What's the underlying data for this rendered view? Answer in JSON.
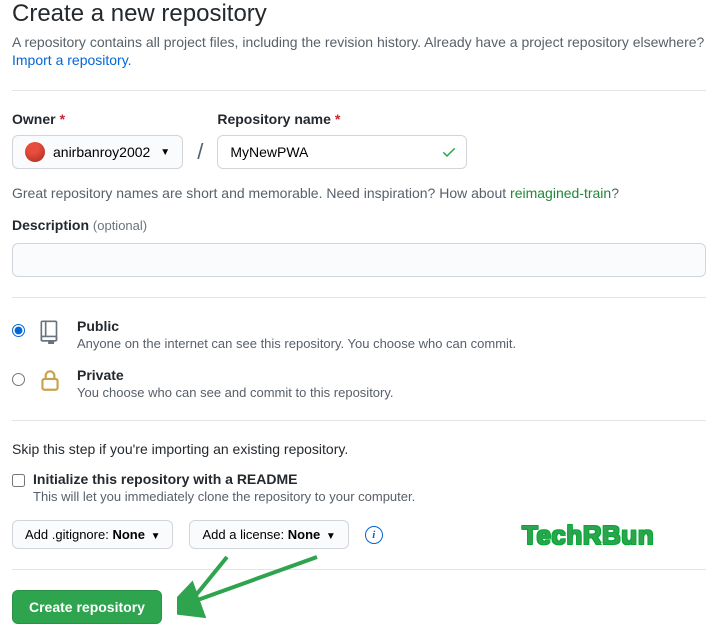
{
  "header": {
    "title": "Create a new repository",
    "subtitle": "A repository contains all project files, including the revision history. Already have a project repository elsewhere?",
    "import_link": "Import a repository."
  },
  "owner": {
    "label": "Owner",
    "username": "anirbanroy2002"
  },
  "repo": {
    "label": "Repository name",
    "value": "MyNewPWA"
  },
  "hint": {
    "prefix": "Great repository names are short and memorable. Need inspiration? How about ",
    "suggestion": "reimagined-train",
    "suffix": "?"
  },
  "description": {
    "label": "Description",
    "optional": "(optional)",
    "value": ""
  },
  "visibility": {
    "public": {
      "title": "Public",
      "desc": "Anyone on the internet can see this repository. You choose who can commit."
    },
    "private": {
      "title": "Private",
      "desc": "You choose who can see and commit to this repository."
    },
    "selected": "public"
  },
  "skip_hint": "Skip this step if you're importing an existing repository.",
  "readme": {
    "title": "Initialize this repository with a README",
    "desc": "This will let you immediately clone the repository to your computer.",
    "checked": false
  },
  "dropdowns": {
    "gitignore_prefix": "Add .gitignore: ",
    "gitignore_value": "None",
    "license_prefix": "Add a license: ",
    "license_value": "None"
  },
  "submit": {
    "label": "Create repository"
  },
  "watermark": "TechRBun"
}
